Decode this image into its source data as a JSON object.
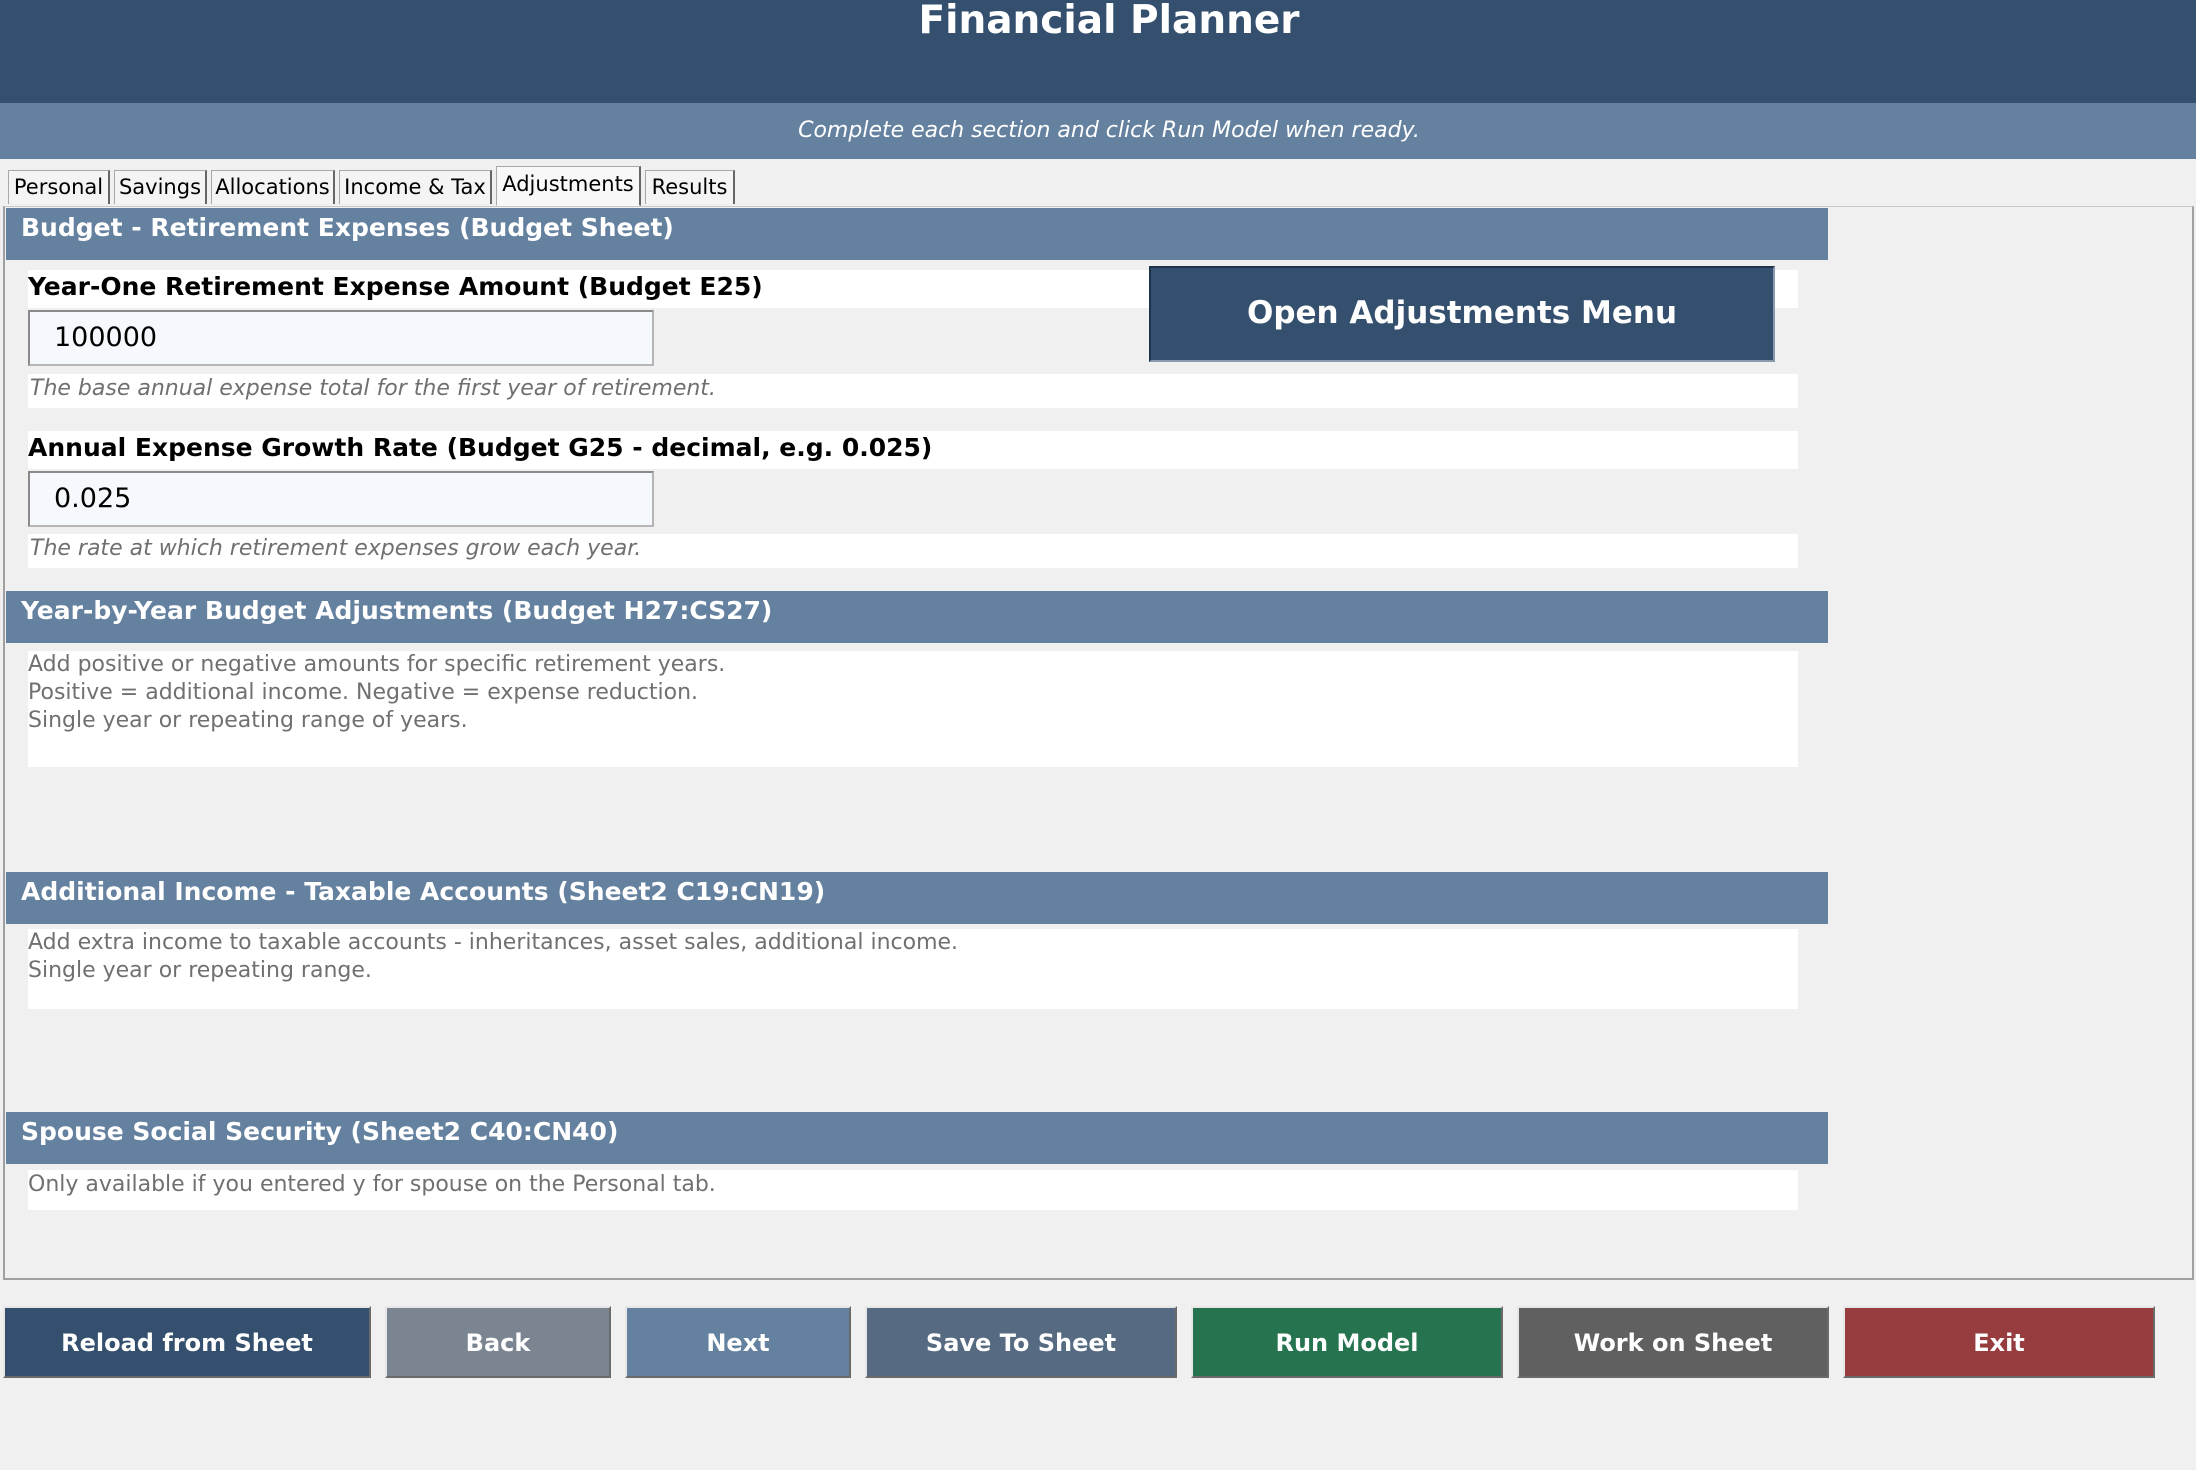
{
  "app": {
    "title": "Financial Planner",
    "subtitle": "Complete each section and click Run Model when ready."
  },
  "tabs": [
    "Personal",
    "Savings",
    "Allocations",
    "Income & Tax",
    "Adjustments",
    "Results"
  ],
  "active_tab": "Adjustments",
  "budget": {
    "header": "Budget - Retirement Expenses  (Budget Sheet)",
    "open_menu_label": "Open Adjustments Menu",
    "expense_label": "Year-One Retirement Expense Amount  (Budget E25)",
    "expense_value": "100000",
    "expense_hint": "The base annual expense total for the first year of retirement.",
    "growth_label": "Annual Expense Growth Rate  (Budget G25 - decimal, e.g. 0.025)",
    "growth_value": "0.025",
    "growth_hint": "The rate at which retirement expenses grow each year."
  },
  "yby": {
    "header": "Year-by-Year Budget Adjustments  (Budget H27:CS27)",
    "lines": [
      "Add positive or negative amounts for specific retirement years.",
      "Positive = additional income.  Negative = expense reduction.",
      "Single year or repeating range of years."
    ]
  },
  "addl": {
    "header": "Additional Income - Taxable Accounts  (Sheet2 C19:CN19)",
    "lines": [
      "Add extra income to taxable accounts - inheritances, asset sales, additional income.",
      "Single year or repeating range."
    ]
  },
  "spouse": {
    "header": "Spouse Social Security  (Sheet2 C40:CN40)",
    "lines": [
      "Only available if you entered y for spouse on the Personal tab."
    ]
  },
  "buttons": {
    "reload": "Reload from Sheet",
    "back": "Back",
    "next": "Next",
    "save": "Save To Sheet",
    "run": "Run Model",
    "work": "Work on Sheet",
    "exit": "Exit"
  },
  "colors": {
    "title_bar": "#34506e",
    "subtitle_bar": "#6581a0",
    "section_header": "#6581a0",
    "btn_reload": "#34506e",
    "btn_back": "#7b8591",
    "btn_next": "#6581a0",
    "btn_save": "#566b82",
    "btn_run": "#25734f",
    "btn_work": "#606060",
    "btn_exit": "#973d40"
  }
}
